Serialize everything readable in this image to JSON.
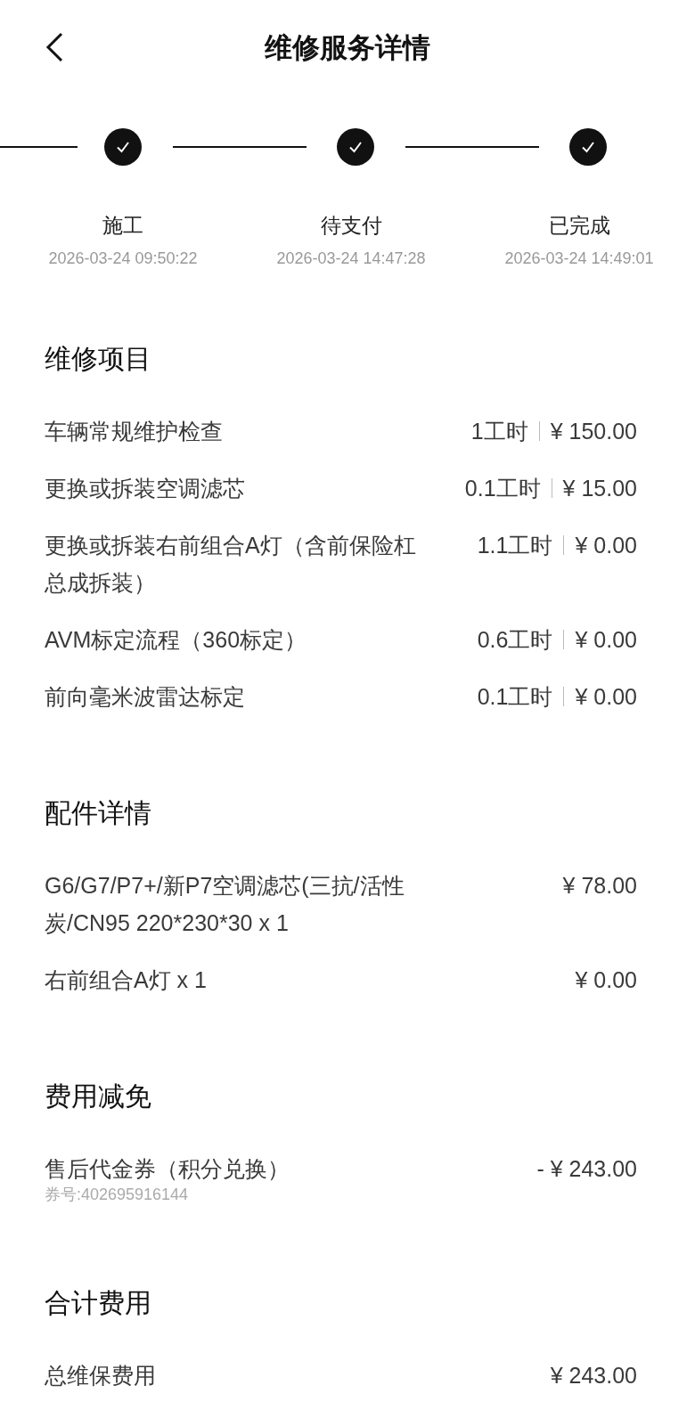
{
  "header": {
    "title": "维修服务详情"
  },
  "steps": [
    {
      "label": "施工",
      "time": "2026-03-24 09:50:22",
      "done": true
    },
    {
      "label": "待支付",
      "time": "2026-03-24 14:47:28",
      "done": true
    },
    {
      "label": "已完成",
      "time": "2026-03-24 14:49:01",
      "done": true
    }
  ],
  "sections": [
    {
      "title": "维修项目",
      "rows": [
        {
          "kind": "labor",
          "name": "车辆常规维护检查",
          "hours": "1工时",
          "price": "¥ 150.00"
        },
        {
          "kind": "labor",
          "name": "更换或拆装空调滤芯",
          "hours": "0.1工时",
          "price": "¥ 15.00"
        },
        {
          "kind": "labor",
          "name": "更换或拆装右前组合A灯（含前保险杠总成拆装）",
          "hours": "1.1工时",
          "price": "¥ 0.00"
        },
        {
          "kind": "labor",
          "name": "AVM标定流程（360标定）",
          "hours": "0.6工时",
          "price": "¥ 0.00"
        },
        {
          "kind": "labor",
          "name": "前向毫米波雷达标定",
          "hours": "0.1工时",
          "price": "¥ 0.00"
        }
      ]
    },
    {
      "title": "配件详情",
      "rows": [
        {
          "kind": "item",
          "name": "G6/G7/P7+/新P7空调滤芯(三抗/活性炭/CN95 220*230*30 x 1",
          "price": "¥ 78.00"
        },
        {
          "kind": "item",
          "name": "右前组合A灯 x 1",
          "price": "¥ 0.00"
        }
      ]
    },
    {
      "title": "费用减免",
      "rows": [
        {
          "kind": "discount",
          "name": "售后代金券（积分兑换）",
          "price": "- ¥ 243.00",
          "note": "券号:402695916144"
        }
      ]
    },
    {
      "title": "合计费用",
      "rows": [
        {
          "kind": "item",
          "name": "总维保费用",
          "price": "¥ 243.00"
        }
      ]
    }
  ]
}
